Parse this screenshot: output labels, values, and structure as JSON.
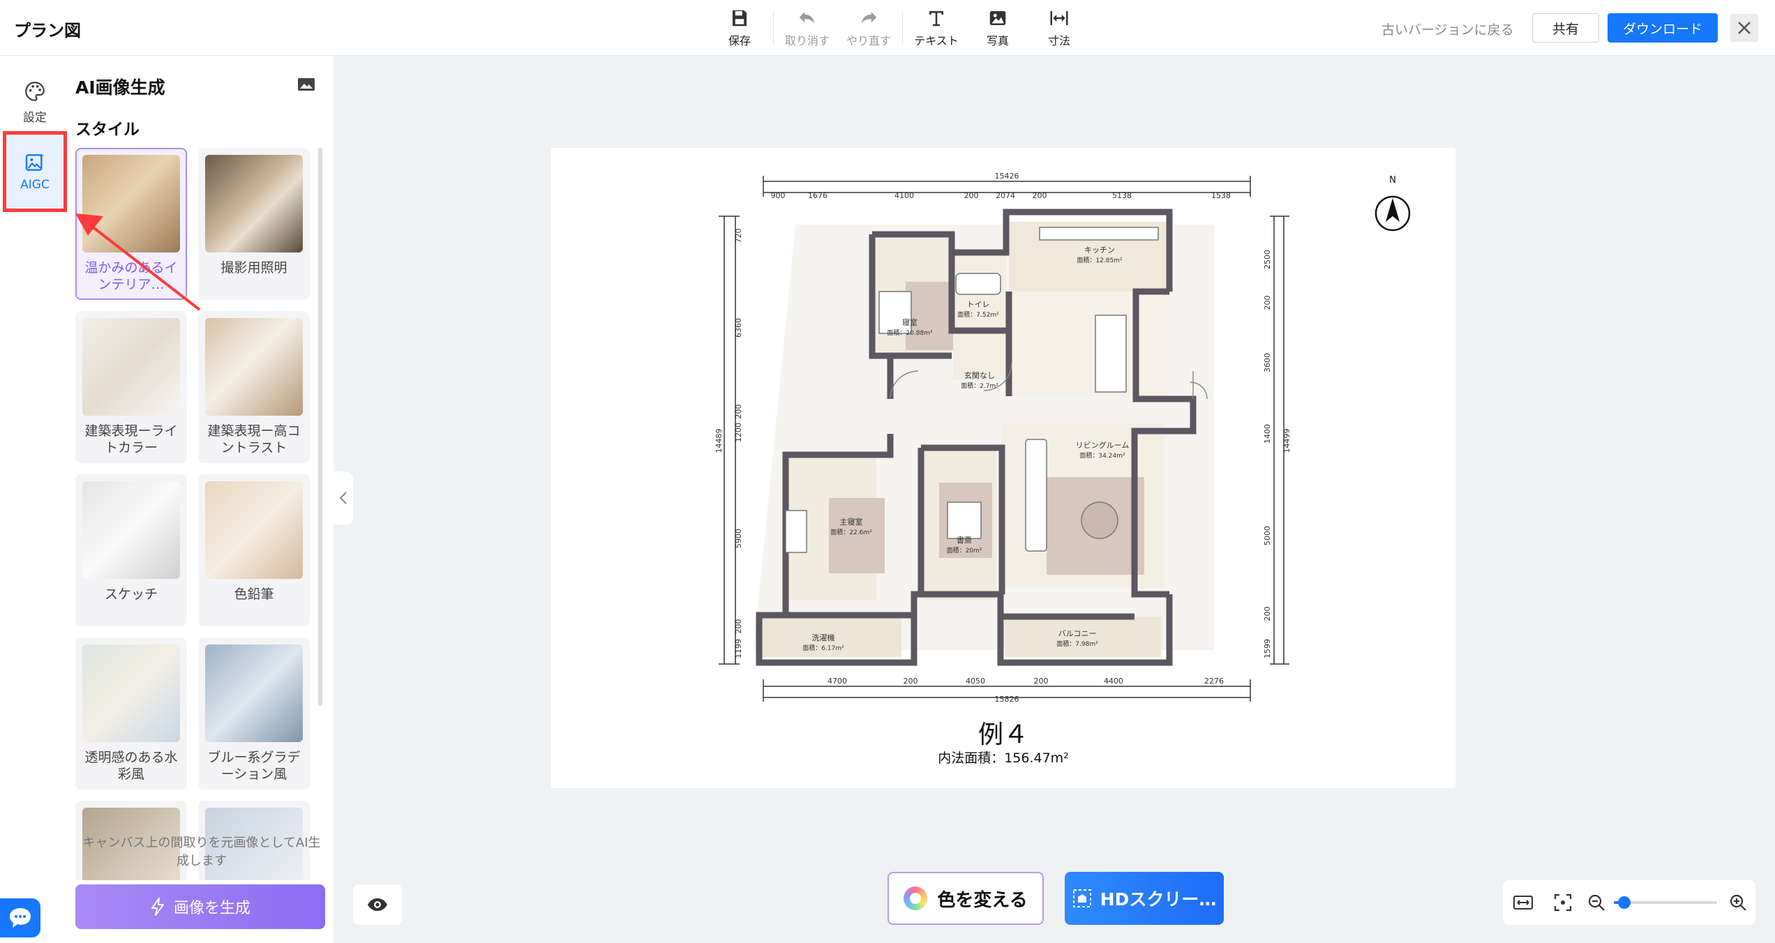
{
  "app": {
    "title": "プラン図"
  },
  "toolbar": {
    "save": "保存",
    "undo": "取り消す",
    "redo": "やり直す",
    "text": "テキスト",
    "photo": "写真",
    "dimension": "寸法"
  },
  "header": {
    "revert": "古いバージョンに戻る",
    "share": "共有",
    "download": "ダウンロード"
  },
  "rail": {
    "settings": "設定",
    "aigc": "AIGC"
  },
  "panel": {
    "title": "AI画像生成",
    "section": "スタイル",
    "styles": [
      {
        "label": "温かみのあるインテリア…",
        "selected": true
      },
      {
        "label": "撮影用照明"
      },
      {
        "label": "建築表現ーライトカラー"
      },
      {
        "label": "建築表現ー高コントラスト"
      },
      {
        "label": "スケッチ"
      },
      {
        "label": "色鉛筆"
      },
      {
        "label": "透明感のある水彩風"
      },
      {
        "label": "ブルー系グラデーション風"
      },
      {
        "label": ""
      },
      {
        "label": ""
      }
    ],
    "hint": "キャンバス上の間取りを元画像としてAI生成します",
    "generate": "画像を生成"
  },
  "plan": {
    "name": "例４",
    "area": "内法面積：156.47m²",
    "north": "N",
    "dim_top_total": "15426",
    "dim_top": [
      "900",
      "1676",
      "4100",
      "200",
      "2074",
      "200",
      "5138",
      "1538"
    ],
    "dim_bottom_total": "15826",
    "dim_bottom": [
      "4700",
      "200",
      "4050",
      "200",
      "4400",
      "2276"
    ],
    "dim_left_total": "14489",
    "dim_left": [
      "720",
      "6360",
      "200",
      "1200",
      "5900",
      "200",
      "1199"
    ],
    "dim_right_total": "14499",
    "dim_right": [
      "2500",
      "200",
      "3600",
      "1400",
      "5000",
      "200",
      "1599"
    ],
    "rooms": [
      {
        "name": "寝室",
        "area": "面積：20.88m²"
      },
      {
        "name": "トイレ",
        "area": "面積：7.52m²"
      },
      {
        "name": "キッチン",
        "area": "面積：12.85m²"
      },
      {
        "name": "玄関なし",
        "area": "面積：2.7m²"
      },
      {
        "name": "リビングルーム",
        "area": "面積：34.24m²"
      },
      {
        "name": "主寝室",
        "area": "面積：22.6m²"
      },
      {
        "name": "書斎",
        "area": "面積：20m²"
      },
      {
        "name": "洗濯機",
        "area": "面積：6.17m²"
      },
      {
        "name": "バルコニー",
        "area": "面積：7.98m²"
      }
    ]
  },
  "bottom": {
    "change_color": "色を変える",
    "hd": "HDスクリー…"
  },
  "zoom": {
    "level": 0.1
  },
  "colors": {
    "accent": "#1677ff",
    "ai": "#8c6cf2",
    "highlight": "#ff3b3b"
  }
}
